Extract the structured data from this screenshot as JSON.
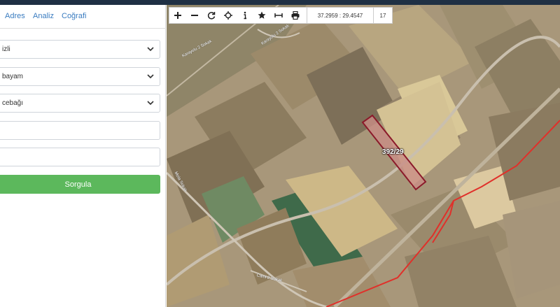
{
  "tabs": {
    "adres": "Adres",
    "analiz": "Analiz",
    "cografi": "Coğrafi"
  },
  "form": {
    "il": "izli",
    "ilce": "bayam",
    "mahalle": "cebağı",
    "ada": "",
    "parsel": "",
    "sorgula": "Sorgula"
  },
  "toolbar": {
    "coords": "37.2959 : 29.4547",
    "zoom": "17",
    "icons": [
      "plus-icon",
      "minus-icon",
      "refresh-icon",
      "crosshair-icon",
      "info-icon",
      "star-icon",
      "measure-icon",
      "print-icon"
    ]
  },
  "map": {
    "parcel_label": "392/29",
    "road_labels": [
      "Karayolu 2 Sokak",
      "Karayolu 2 Sokak",
      "Cami 2 Sokak",
      "Mola Sokak"
    ]
  },
  "colors": {
    "accent": "#3a7cc0",
    "button": "#5cb85c",
    "parcel": "#8b1a2a",
    "powerline": "#e0302a"
  }
}
